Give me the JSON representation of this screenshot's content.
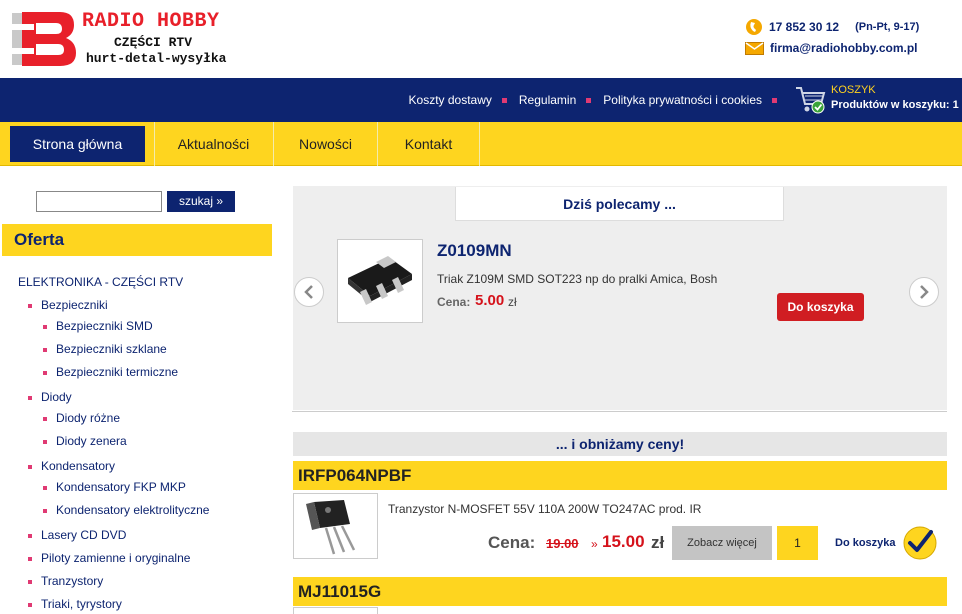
{
  "header": {
    "brand_name": "RADIO HOBBY",
    "brand_sub1": "CZĘŚCI RTV",
    "brand_sub2": "hurt-detal-wysyłka",
    "phone": "17 852 30 12",
    "phone_hours": "(Pn-Pt, 9-17)",
    "email": "firma@radiohobby.com.pl"
  },
  "topbar": {
    "links": [
      "Koszty dostawy",
      "Regulamin",
      "Polityka prywatności i cookies"
    ],
    "cart_title": "KOSZYK",
    "cart_count_label": "Produktów w koszyku:",
    "cart_count": "1"
  },
  "nav": {
    "items": [
      "Strona główna",
      "Aktualności",
      "Nowości",
      "Kontakt"
    ]
  },
  "sidebar": {
    "search_button": "szukaj »",
    "offer_title": "Oferta",
    "categories": [
      "ELEKTRONIKA - CZĘŚCI RTV",
      "Bezpieczniki",
      "Bezpieczniki SMD",
      "Bezpieczniki szklane",
      "Bezpieczniki termiczne",
      "Diody",
      "Diody różne",
      "Diody zenera",
      "Kondensatory",
      "Kondensatory FKP MKP",
      "Kondensatory elektrolityczne",
      "Lasery CD DVD",
      "Piloty zamienne i oryginalne",
      "Tranzystory",
      "Triaki, tyrystory"
    ]
  },
  "recommended": {
    "title": "Dziś polecamy ...",
    "product_name": "Z0109MN",
    "product_desc": "Triak Z109M SMD SOT223  np do pralki Amica, Bosh",
    "price_label": "Cena:",
    "price": "5.00",
    "currency": "zł",
    "cart_button": "Do koszyka"
  },
  "discounts": {
    "title": "... i obniżamy ceny!",
    "products": [
      {
        "name": "IRFP064NPBF",
        "desc": "Tranzystor N-MOSFET 55V 110A 200W TO247AC prod. IR",
        "price_label": "Cena:",
        "old_price": "19.00",
        "arrow": "»",
        "new_price": "15.00",
        "currency": "zł",
        "more_button": "Zobacz więcej",
        "quantity": "1",
        "add_label": "Do koszyka"
      },
      {
        "name": "MJ11015G"
      }
    ]
  },
  "colors": {
    "navy": "#0d2470",
    "yellow": "#fed51f",
    "red": "#d01d22",
    "pink": "#e03a73"
  }
}
